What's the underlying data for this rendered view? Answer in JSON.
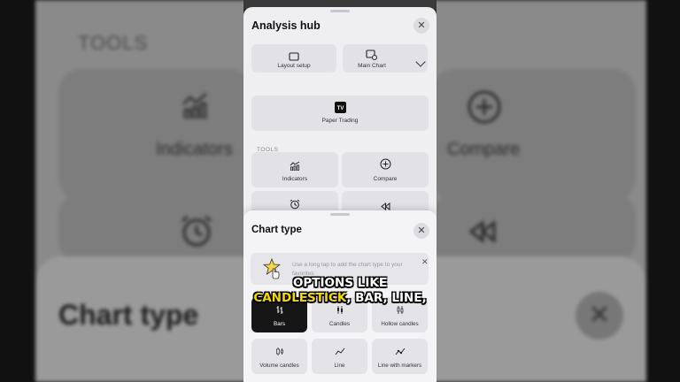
{
  "background": {
    "tools": "TOOLS",
    "indicators": "Indicators",
    "compare": "Compare",
    "chart_type": "Chart type"
  },
  "analysis_hub": {
    "title": "Analysis hub",
    "layout_setup": "Layout setup",
    "main_chart": "Main Chart",
    "paper_trading": "Paper Trading",
    "tools_section": "TOOLS",
    "indicators": "Indicators",
    "compare": "Compare"
  },
  "chart_type": {
    "title": "Chart type",
    "hint": "Use a long tap to add the chart type to your favorites",
    "types": [
      "Bars",
      "Candles",
      "Hollow candles",
      "Volume candles",
      "Line",
      "Line with markers"
    ],
    "selected": "Bars"
  },
  "caption": {
    "line1": "OPTIONS LIKE",
    "highlight": "CANDLESTICK",
    "line2_rest": ", BAR, LINE,"
  },
  "colors": {
    "selected_tile": "#161616",
    "caption_highlight": "#f5d900"
  }
}
